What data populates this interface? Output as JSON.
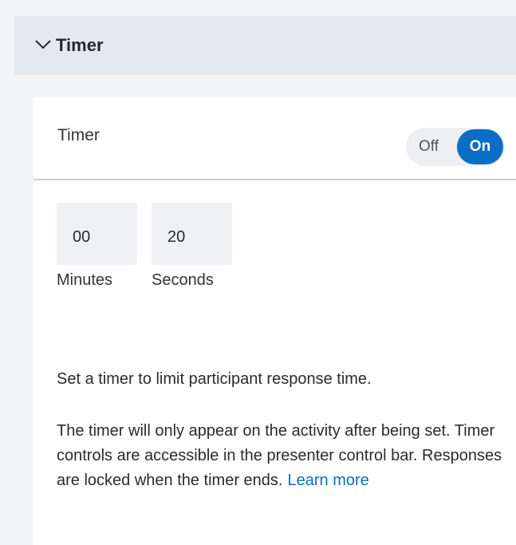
{
  "section": {
    "title": "Timer",
    "chevron_icon": "chevron-down-icon"
  },
  "timer_row": {
    "label": "Timer",
    "toggle": {
      "off_label": "Off",
      "on_label": "On",
      "state": "on"
    }
  },
  "time": {
    "minutes_value": "00",
    "seconds_value": "20",
    "minutes_label": "Minutes",
    "seconds_label": "Seconds"
  },
  "description": {
    "line1": "Set a timer to limit participant response time.",
    "paragraph2": "The timer will only appear on the activity after being set. Timer controls are accessible in the presenter control bar. Responses are locked when the timer ends.",
    "learn_more": "Learn more"
  },
  "colors": {
    "accent": "#0a6ec7",
    "header_bg": "#e3e9f1"
  }
}
